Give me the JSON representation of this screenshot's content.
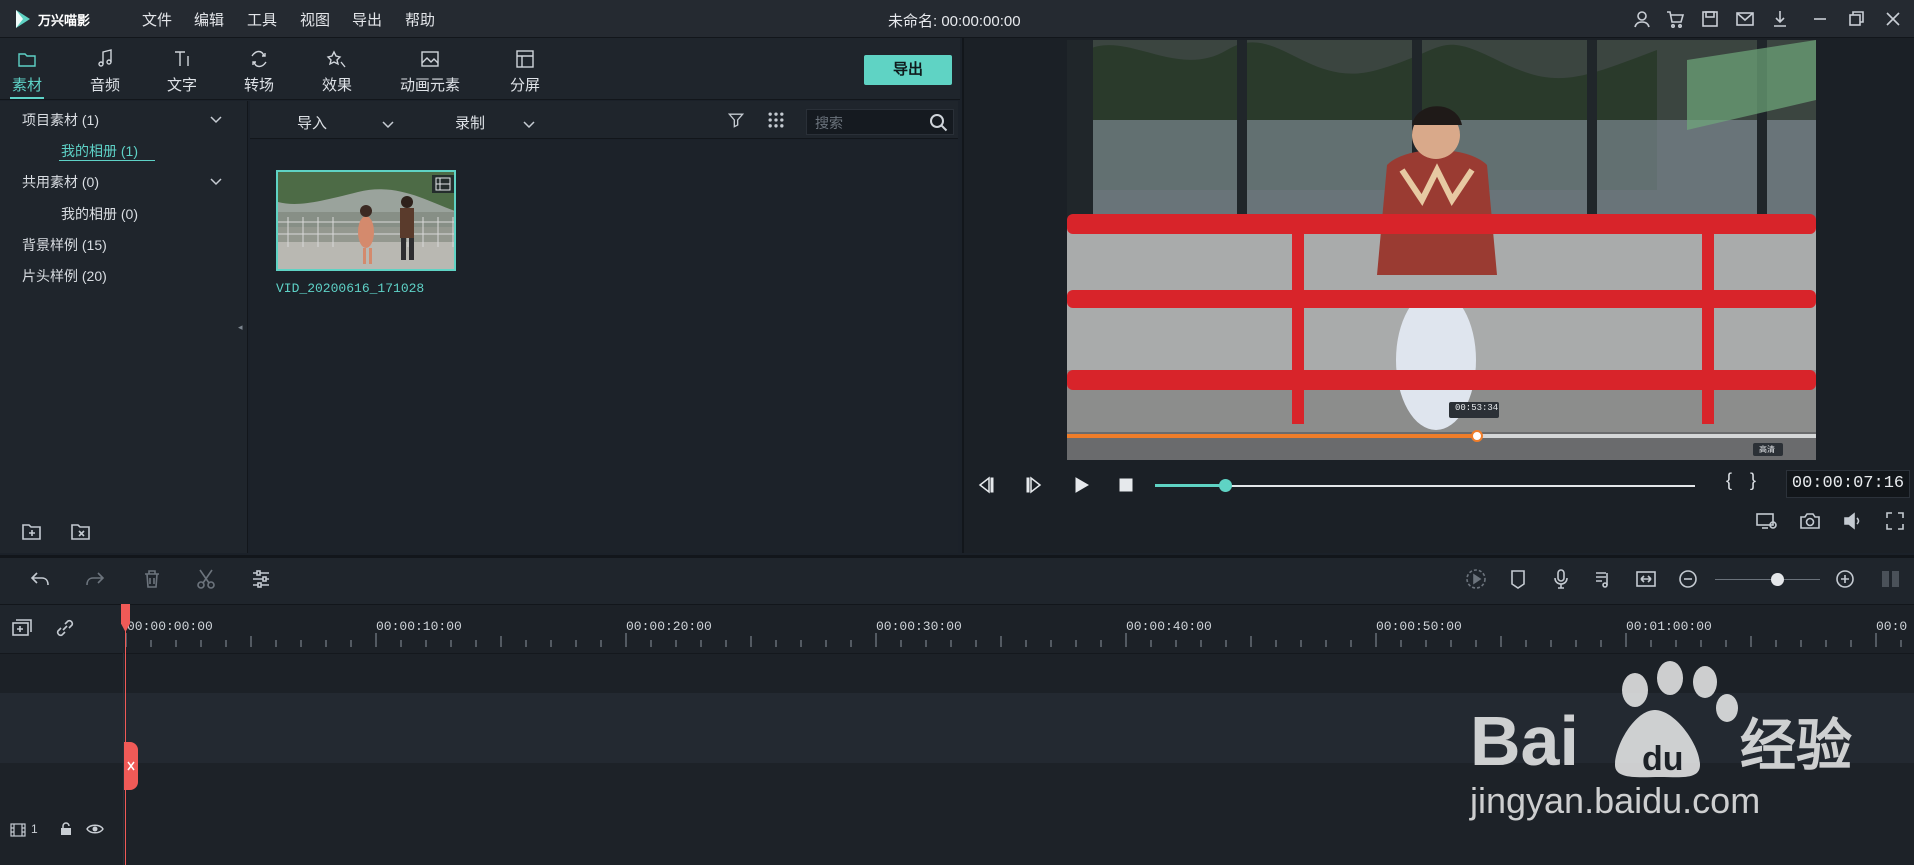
{
  "app": {
    "name": "万兴喵影",
    "doc_title": "未命名: 00:00:00:00"
  },
  "menu": [
    "文件",
    "编辑",
    "工具",
    "视图",
    "导出",
    "帮助"
  ],
  "tabs": [
    {
      "label": "素材",
      "icon": "folder-icon"
    },
    {
      "label": "音频",
      "icon": "music-note-icon"
    },
    {
      "label": "文字",
      "icon": "text-icon"
    },
    {
      "label": "转场",
      "icon": "transition-icon"
    },
    {
      "label": "效果",
      "icon": "effects-icon"
    },
    {
      "label": "动画元素",
      "icon": "image-icon"
    },
    {
      "label": "分屏",
      "icon": "split-screen-icon"
    }
  ],
  "export_button": "导出",
  "library": {
    "items": [
      {
        "label": "项目素材 (1)"
      },
      {
        "label": "我的相册 (1)"
      },
      {
        "label": "共用素材 (0)"
      },
      {
        "label": "我的相册 (0)"
      },
      {
        "label": "背景样例 (15)"
      },
      {
        "label": "片头样例 (20)"
      }
    ]
  },
  "media_toolbar": {
    "import": "导入",
    "record": "录制",
    "search_placeholder": "搜索"
  },
  "media": {
    "clip_name": "VID_20200616_171028"
  },
  "preview": {
    "timecode": "00:00:07:16",
    "overlay_time": "00:53:34",
    "overlay_tag": "高清",
    "progress": 0.13
  },
  "timeline": {
    "ruler": [
      "00:00:00:00",
      "00:00:10:00",
      "00:00:20:00",
      "00:00:30:00",
      "00:00:40:00",
      "00:00:50:00",
      "00:01:00:00",
      "00:0"
    ],
    "track_number": "1"
  },
  "watermark": {
    "text": "jingyan.baidu.com",
    "brand": "Bai du 经验"
  },
  "colors": {
    "accent": "#5fd3c4",
    "playhead": "#f05a57"
  }
}
